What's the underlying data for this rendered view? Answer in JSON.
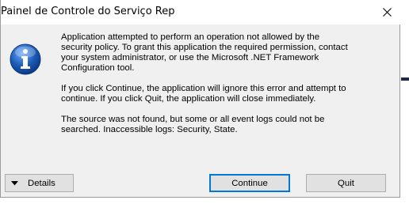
{
  "window": {
    "title": "Painel de Controle do Serviço Rep",
    "close_icon": "close-icon"
  },
  "message": {
    "icon": "info-icon",
    "paragraphs": [
      "Application attempted to perform an operation not allowed by the\nsecurity policy. To grant this application the required permission, contact\nyour system administrator, or use the Microsoft .NET Framework\nConfiguration tool.",
      "If you click Continue, the application will ignore this error and attempt to\ncontinue. If you click Quit, the application will close immediately.",
      "The source was not found, but some or all event logs could not be\nsearched.  Inaccessible logs: Security, State."
    ]
  },
  "buttons": {
    "details_label": "Details",
    "continue_label": "Continue",
    "quit_label": "Quit"
  },
  "colors": {
    "dialog_bg": "#f0f0f0",
    "button_bg": "#e1e1e1",
    "focus_border": "#0078d7",
    "icon_blue": "#1c5cb5"
  }
}
